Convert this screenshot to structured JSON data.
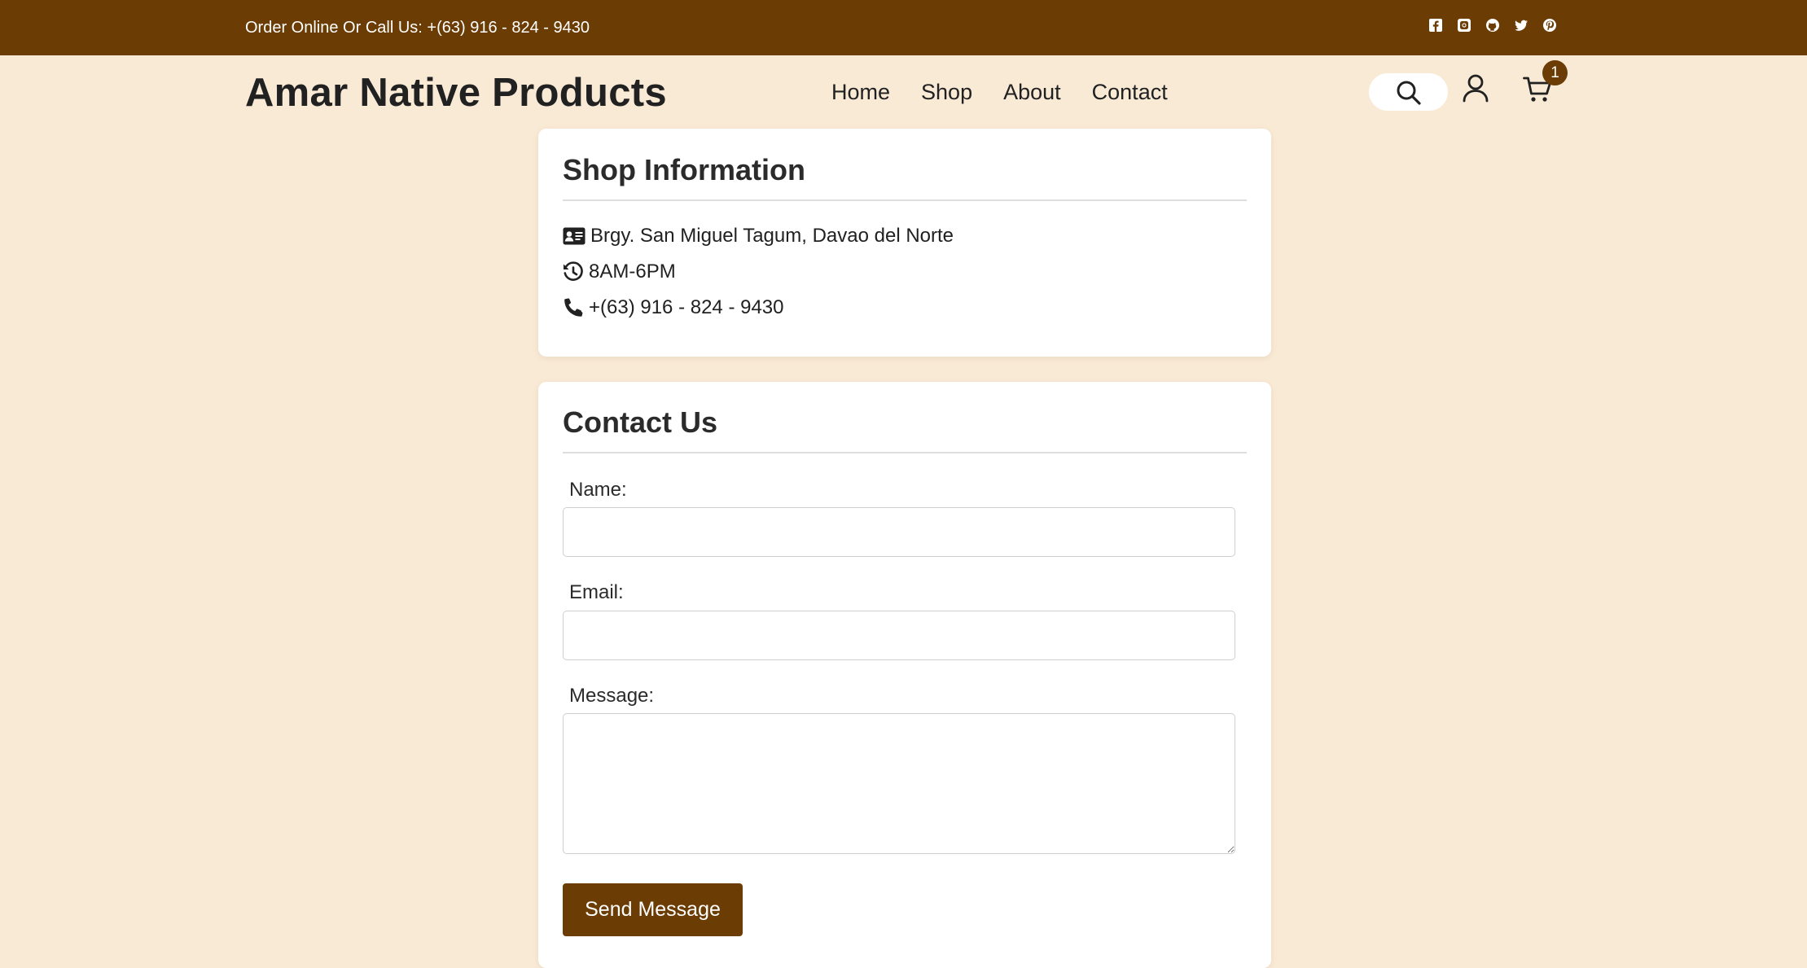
{
  "topbar": {
    "text": "Order Online Or Call Us: +(63) 916 - 824 - 9430",
    "socials": [
      "facebook-icon",
      "instagram-icon",
      "github-icon",
      "twitter-icon",
      "pinterest-icon"
    ]
  },
  "header": {
    "brand": "Amar Native Products",
    "nav": [
      "Home",
      "Shop",
      "About",
      "Contact"
    ],
    "cart_count": "1"
  },
  "shop_info": {
    "title": "Shop Information",
    "address": "Brgy. San Miguel Tagum, Davao del Norte",
    "hours": "8AM-6PM",
    "phone": "+(63) 916 - 824 - 9430"
  },
  "contact": {
    "title": "Contact Us",
    "name_label": "Name:",
    "email_label": "Email:",
    "message_label": "Message:",
    "name_value": "",
    "email_value": "",
    "message_value": "",
    "send_label": "Send Message"
  },
  "colors": {
    "brand_brown": "#6b3c03",
    "page_background": "#f9ead6",
    "card_background": "#ffffff"
  }
}
